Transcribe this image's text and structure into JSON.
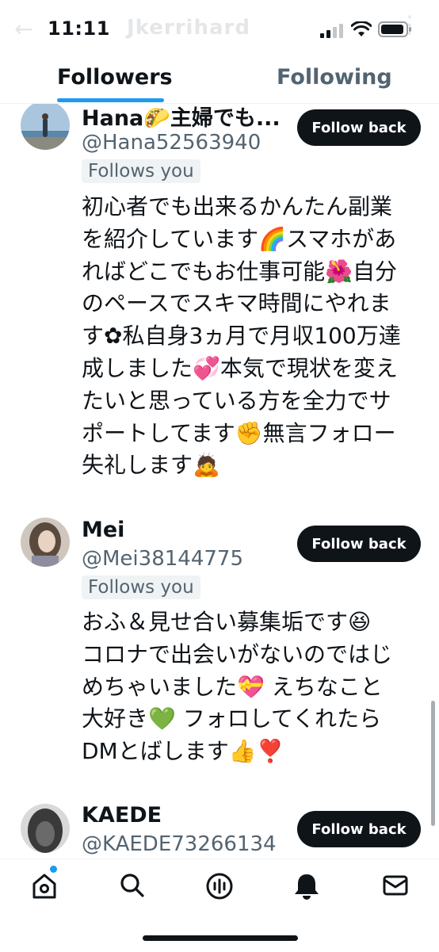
{
  "status_bar": {
    "time": "11:11",
    "ghost_title": "Jkerrihard"
  },
  "tabs": [
    {
      "label": "Followers",
      "selected": true
    },
    {
      "label": "Following",
      "selected": false
    }
  ],
  "follow_button_label": "Follow back",
  "follows_you_label": "Follows you",
  "users": [
    {
      "name": "Hana🌮主婦でも...",
      "handle": "@Hana52563940",
      "bio_lines": [
        "初心者でも出来るかんたん副業",
        "を紹介しています🌈スマホがあ",
        "ればどこでもお仕事可能🌺自分",
        "のペースでスキマ時間にやれま",
        "す✿私自身3ヵ月で月収100万達",
        "成しました💞本気で現状を変え",
        "たいと思っている方を全力でサ",
        "ポートしてます✊無言フォロー",
        "失礼します🙇"
      ]
    },
    {
      "name": "Mei",
      "handle": "@Mei38144775",
      "bio_lines": [
        "おふ＆見せ合い募集垢です😆",
        "コロナで出会いがないのではじ",
        "めちゃいました💝 えちなこと",
        "大好き💚 フォロしてくれたら",
        "DMとばします👍❣️"
      ]
    },
    {
      "name": "KAEDE",
      "handle": "@KAEDE73266134",
      "bio_lines": []
    }
  ],
  "bottom_nav": [
    {
      "icon": "home-icon",
      "has_notification_dot": true
    },
    {
      "icon": "search-icon"
    },
    {
      "icon": "spaces-icon"
    },
    {
      "icon": "bell-icon"
    },
    {
      "icon": "mail-icon"
    }
  ],
  "colors": {
    "accent": "#1d9bf0",
    "text": "#0f1419",
    "muted": "#536471",
    "button_bg": "#0f1419"
  }
}
